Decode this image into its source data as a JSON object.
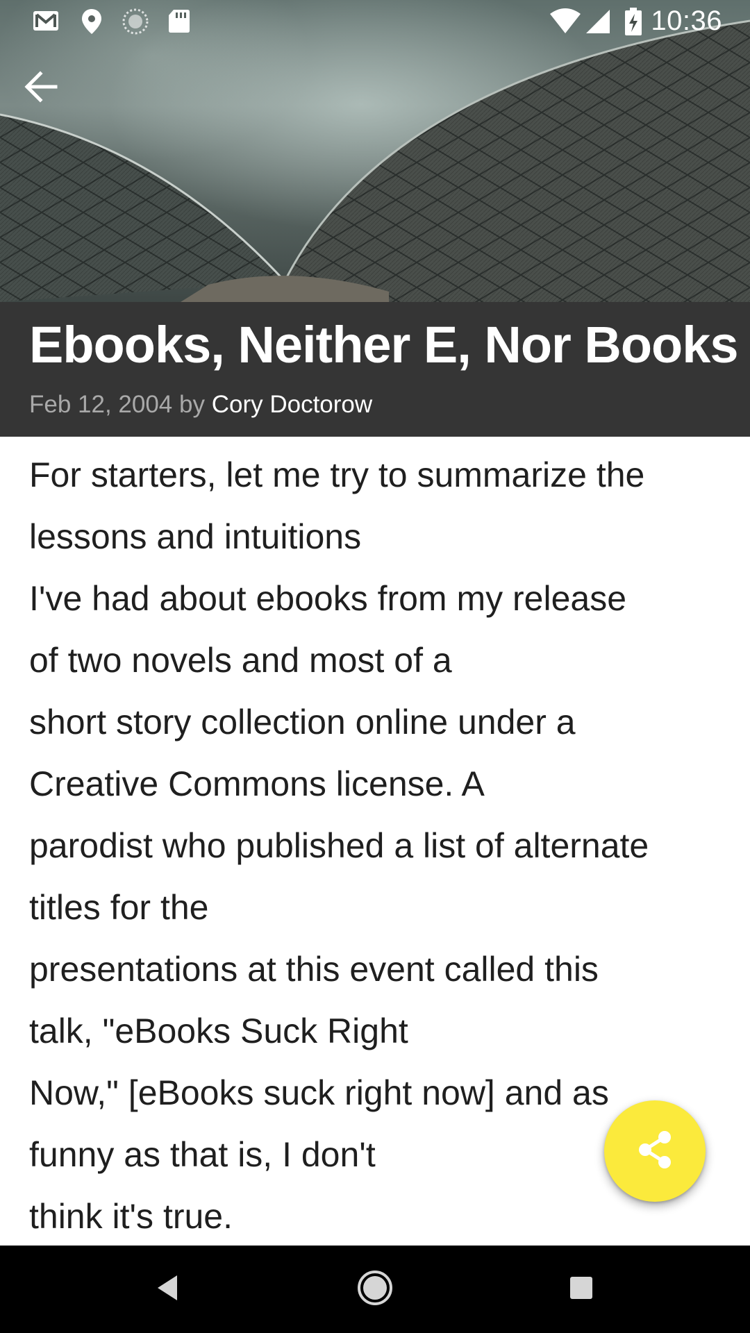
{
  "status_bar": {
    "time": "10:36",
    "left_icons": [
      "gmail-icon",
      "location-pin-icon",
      "sync-progress-icon",
      "sd-card-icon"
    ],
    "right_icons": [
      "wifi-icon",
      "cell-signal-icon",
      "battery-charging-icon"
    ]
  },
  "toolbar": {
    "back_icon": "arrow-back-icon"
  },
  "article": {
    "title": "Ebooks, Neither E, Nor Books",
    "date": "Feb 12, 2004",
    "by": "by",
    "author": "Cory Doctorow",
    "body_lines": [
      "For starters, let me try to summarize the",
      "lessons and intuitions",
      "I've had about ebooks from my release",
      "of two novels and most of a",
      "short story collection online under a",
      "Creative Commons license. A",
      "parodist who published a list of alternate",
      "titles for the",
      "presentations at this event called this",
      "talk, \"eBooks Suck Right",
      "Now,\" [eBooks suck right now] and as",
      "funny as that is, I don't",
      "think it's true."
    ]
  },
  "fab": {
    "icon": "share-icon",
    "color": "#FBEA3C"
  },
  "nav_bar": {
    "icons": [
      "nav-back-icon",
      "nav-home-icon",
      "nav-recents-icon"
    ]
  },
  "colors": {
    "title_band": "#353535",
    "byline_date": "#A9A9A9",
    "body_text": "#1F1F1F",
    "nav_bar": "#000000"
  }
}
